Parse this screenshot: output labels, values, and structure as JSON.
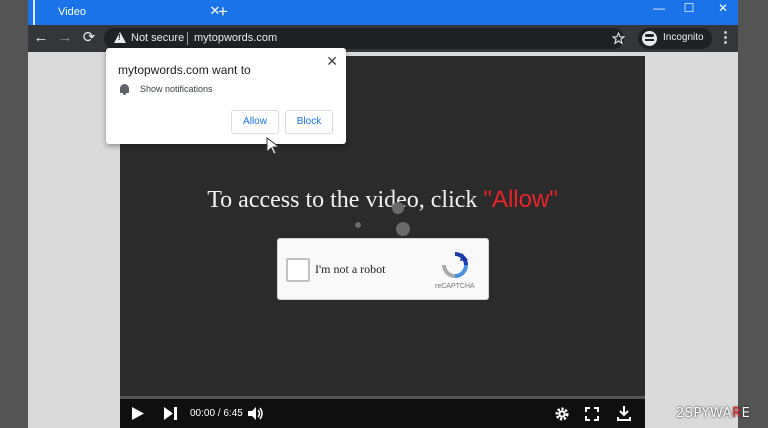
{
  "tab": {
    "title": "Video",
    "close": "✕",
    "new_tab": "+"
  },
  "window_controls": {
    "minimize": "—",
    "maximize": "☐",
    "close": "✕"
  },
  "toolbar": {
    "back": "←",
    "forward": "→",
    "reload": "⟳",
    "security_label": "Not secure",
    "url": "mytopwords.com",
    "incognito_label": "Incognito",
    "menu": "⋮"
  },
  "notification_popup": {
    "title": "mytopwords.com want to",
    "permission": "Show notifications",
    "allow": "Allow",
    "block": "Block",
    "close": "✕"
  },
  "page": {
    "headline_prefix": "To access to the video, click ",
    "headline_highlight": "\"Allow\"",
    "captcha_label": "I'm not a robot",
    "recaptcha_brand": "reCAPTCHA"
  },
  "player": {
    "time": "00:00 / 6:45"
  },
  "watermark": {
    "prefix": "2SPYWA",
    "accent": "R",
    "suffix": "E"
  },
  "colors": {
    "brand_blue": "#1a73e8",
    "allow_red": "#e8232a",
    "toolbar": "#35363a",
    "player_bg": "#2b2b2b"
  }
}
